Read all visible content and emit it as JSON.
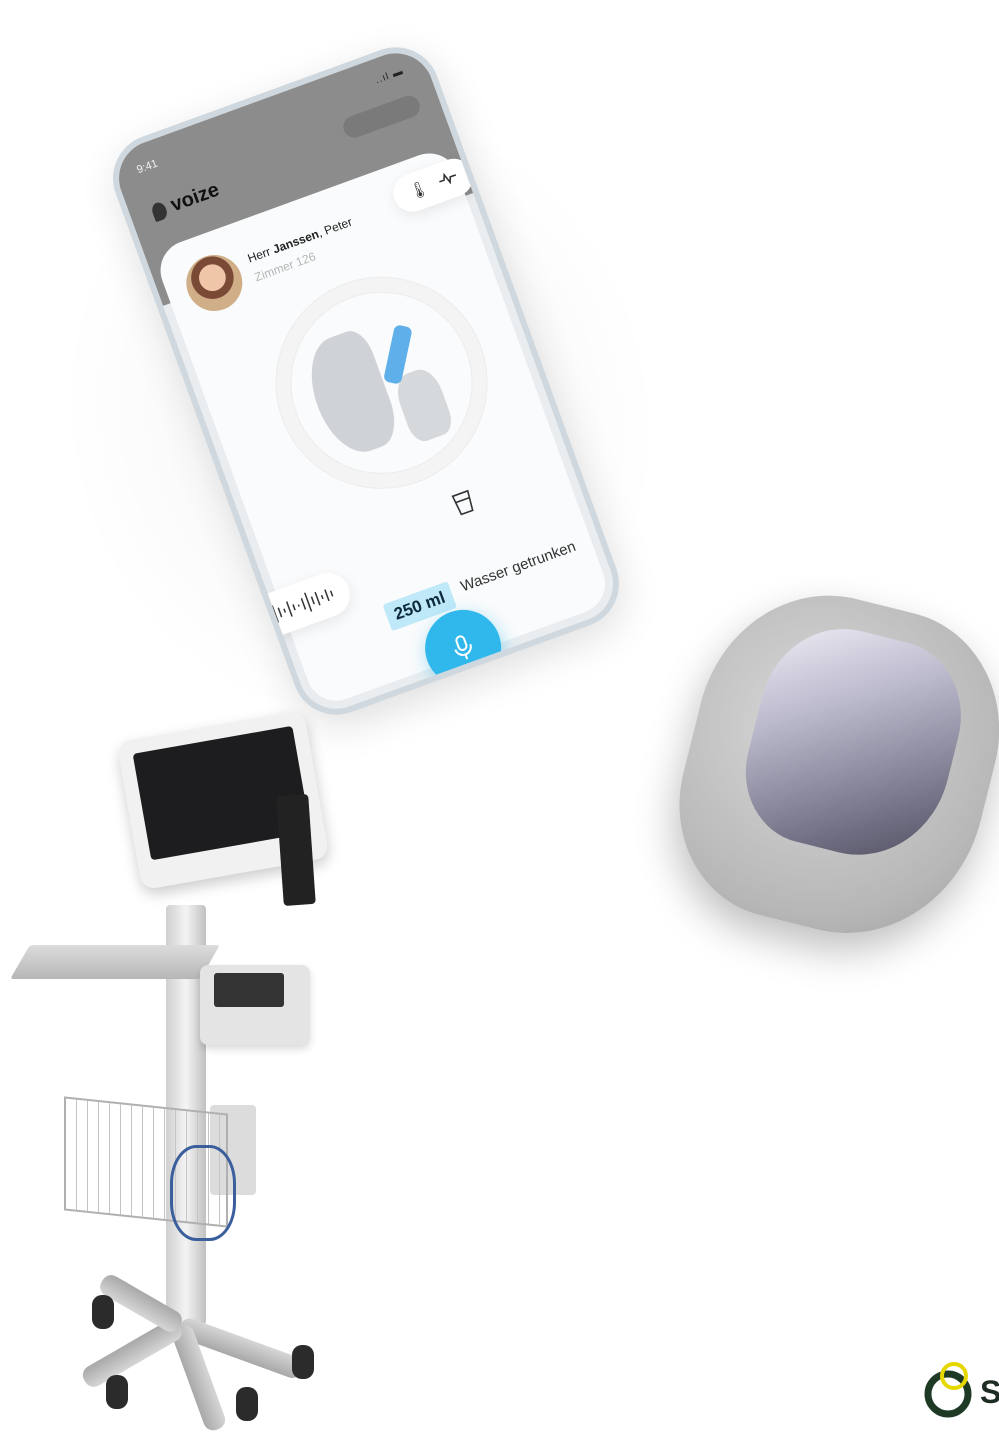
{
  "phone": {
    "status_time": "9:41",
    "status_icons": "..ıl ▬",
    "app_name": "voize",
    "patient": {
      "salutation": "Herr",
      "last_name": "Janssen",
      "first_name": ", Peter",
      "room": "Zimmer 126"
    },
    "vitals_icons": [
      "thermometer-icon",
      "pulse-icon"
    ],
    "amount": "250 ml",
    "drink_label": "Wasser getrunken",
    "mic_icon": "microphone-icon",
    "accent_color": "#30b8ec",
    "highlight_color": "#bfe9f8"
  },
  "corner_logo": {
    "text": "S"
  }
}
